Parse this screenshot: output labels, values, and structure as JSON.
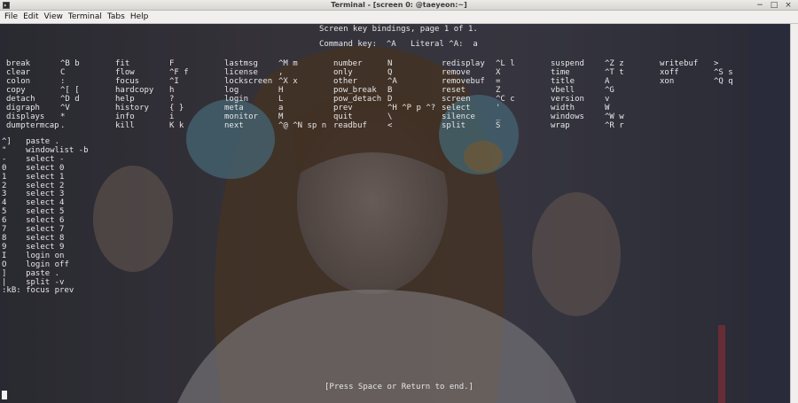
{
  "window": {
    "title": "Terminal - [screen 0:          @taeyeon:~]"
  },
  "menu": [
    "File",
    "Edit",
    "View",
    "Terminal",
    "Tabs",
    "Help"
  ],
  "screen_help": {
    "header": "Screen key bindings, page 1 of 1.",
    "command_key": "Command key:  ^A   Literal ^A:  a",
    "columns": [
      [
        [
          "break",
          "^B b"
        ],
        [
          "clear",
          "C"
        ],
        [
          "colon",
          ":"
        ],
        [
          "copy",
          "^[ ["
        ],
        [
          "detach",
          "^D d"
        ],
        [
          "digraph",
          "^V"
        ],
        [
          "displays",
          "*"
        ],
        [
          "dumptermcap",
          "."
        ]
      ],
      [
        [
          "fit",
          "F"
        ],
        [
          "flow",
          "^F f"
        ],
        [
          "focus",
          "^I"
        ],
        [
          "hardcopy",
          "h"
        ],
        [
          "help",
          "?"
        ],
        [
          "history",
          "{ }"
        ],
        [
          "info",
          "i"
        ],
        [
          "kill",
          "K k"
        ]
      ],
      [
        [
          "lastmsg",
          "^M m"
        ],
        [
          "license",
          ","
        ],
        [
          "lockscreen",
          "^X x"
        ],
        [
          "log",
          "H"
        ],
        [
          "login",
          "L"
        ],
        [
          "meta",
          "a"
        ],
        [
          "monitor",
          "M"
        ],
        [
          "next",
          "^@ ^N sp n"
        ]
      ],
      [
        [
          "number",
          "N"
        ],
        [
          "only",
          "Q"
        ],
        [
          "other",
          "^A"
        ],
        [
          "pow_break",
          "B"
        ],
        [
          "pow_detach",
          "D"
        ],
        [
          "prev",
          "^H ^P p ^?"
        ],
        [
          "quit",
          "\\"
        ],
        [
          "readbuf",
          "<"
        ]
      ],
      [
        [
          "redisplay",
          "^L l"
        ],
        [
          "remove",
          "X"
        ],
        [
          "removebuf",
          "="
        ],
        [
          "reset",
          "Z"
        ],
        [
          "screen",
          "^C c"
        ],
        [
          "select",
          "'"
        ],
        [
          "silence",
          "_"
        ],
        [
          "split",
          "S"
        ]
      ],
      [
        [
          "suspend",
          "^Z z"
        ],
        [
          "time",
          "^T t"
        ],
        [
          "title",
          "A"
        ],
        [
          "vbell",
          "^G"
        ],
        [
          "version",
          "v"
        ],
        [
          "width",
          "W"
        ],
        [
          "windows",
          "^W w"
        ],
        [
          "wrap",
          "^R r"
        ]
      ],
      [
        [
          "writebuf",
          ">"
        ],
        [
          "xoff",
          "^S s"
        ],
        [
          "xon",
          "^Q q"
        ]
      ]
    ],
    "extra_bindings": [
      "^]   paste .",
      "\"    windowlist -b",
      "-    select -",
      "0    select 0",
      "1    select 1",
      "2    select 2",
      "3    select 3",
      "4    select 4",
      "5    select 5",
      "6    select 6",
      "7    select 7",
      "8    select 8",
      "9    select 9",
      "I    login on",
      "O    login off",
      "]    paste .",
      "|    split -v",
      ":kB: focus prev"
    ],
    "footer": "[Press Space or Return to end.]"
  }
}
